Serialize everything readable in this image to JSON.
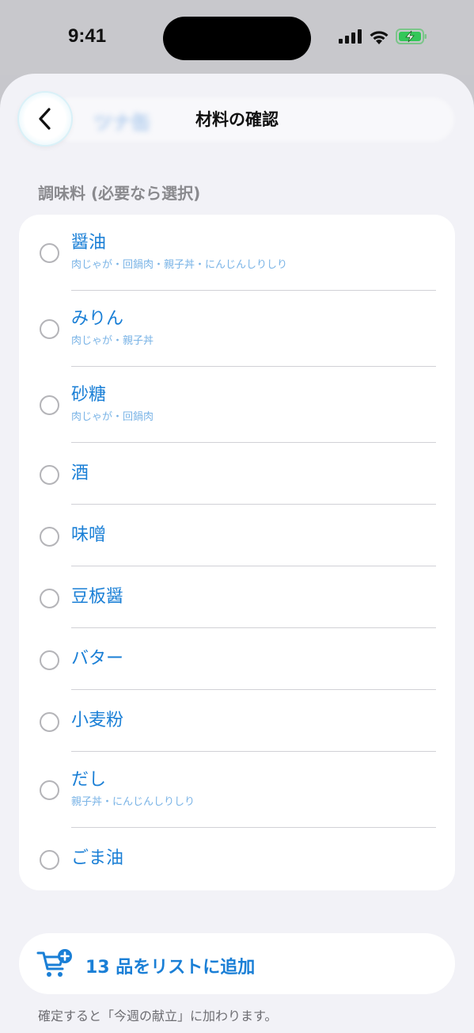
{
  "status_bar": {
    "time": "9:41"
  },
  "nav": {
    "title": "材料の確認",
    "ghost_text": "ツナ缶"
  },
  "section": {
    "header": "調味料 (必要なら選択)"
  },
  "items": [
    {
      "name": "醤油",
      "sub": "肉じゃが・回鍋肉・親子丼・にんじんしりしり"
    },
    {
      "name": "みりん",
      "sub": "肉じゃが・親子丼"
    },
    {
      "name": "砂糖",
      "sub": "肉じゃが・回鍋肉"
    },
    {
      "name": "酒",
      "sub": ""
    },
    {
      "name": "味噌",
      "sub": ""
    },
    {
      "name": "豆板醤",
      "sub": ""
    },
    {
      "name": "バター",
      "sub": ""
    },
    {
      "name": "小麦粉",
      "sub": ""
    },
    {
      "name": "だし",
      "sub": "親子丼・にんじんしりしり"
    },
    {
      "name": "ごま油",
      "sub": ""
    }
  ],
  "add_button": {
    "label": "13 品をリストに追加"
  },
  "footnote": "確定すると「今週の献立」に加わります。",
  "colors": {
    "accent": "#1a7fd6",
    "sub_text": "#79b3e6",
    "background": "#f2f2f7"
  },
  "icons": [
    "signal-icon",
    "wifi-icon",
    "battery-charging-icon",
    "chevron-left-icon",
    "cart-plus-icon"
  ]
}
